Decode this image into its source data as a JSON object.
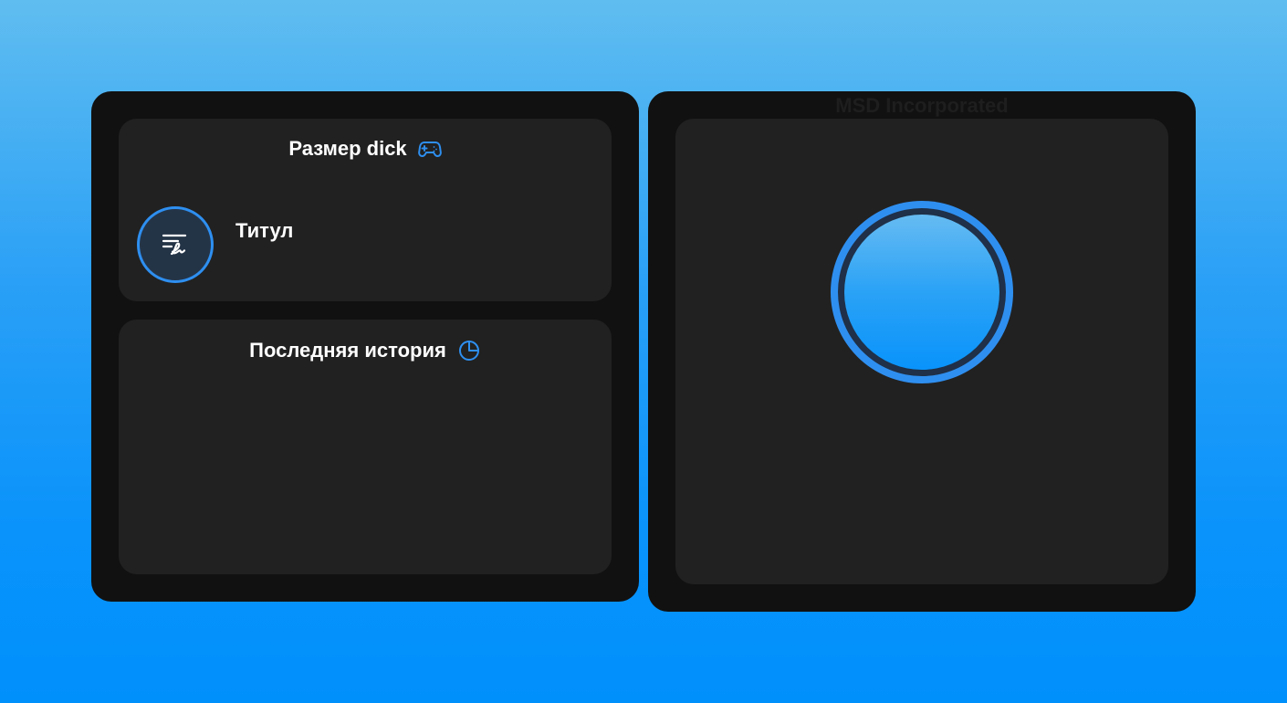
{
  "size_card": {
    "title": "Размер dick",
    "title_icon": "gamepad-icon",
    "rank_label": "Титул",
    "avatar_icon": "signature-icon"
  },
  "history_card": {
    "title": "Последняя история",
    "title_icon": "pie-chart-icon"
  },
  "clicker": {
    "company_name": "MSD Incorporated",
    "button_icon": "circle-button"
  },
  "colors": {
    "accent": "#2e8ff0",
    "panel_background": "#111111",
    "card_background": "#212121",
    "page_gradient_top": "#60bdf0",
    "page_gradient_bottom": "#0090fc"
  }
}
